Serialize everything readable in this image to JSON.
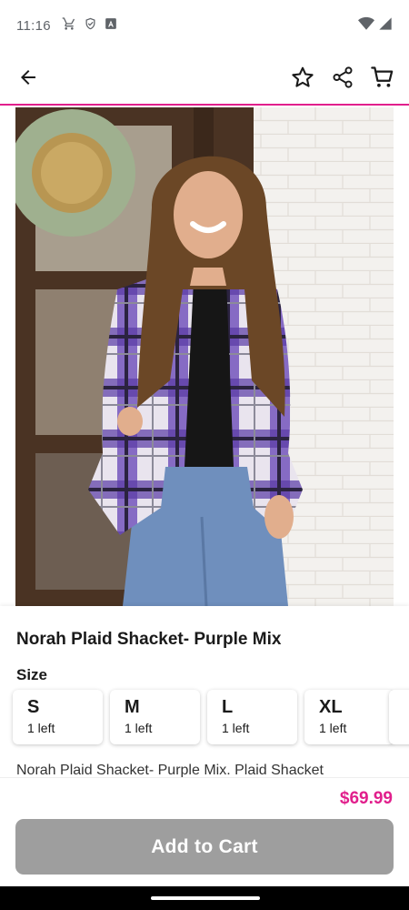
{
  "status_bar": {
    "time": "11:16",
    "icons": [
      "cart-icon",
      "shield-icon",
      "a-box-icon"
    ],
    "right_icons": [
      "wifi-icon",
      "signal-icon"
    ]
  },
  "app_bar": {
    "icons": [
      "back-arrow-icon",
      "star-outline-icon",
      "share-icon",
      "cart-icon"
    ]
  },
  "product": {
    "title": "Norah Plaid Shacket- Purple Mix",
    "size_label": "Size",
    "sizes": [
      {
        "size": "S",
        "stock": "1 left"
      },
      {
        "size": "M",
        "stock": "1 left"
      },
      {
        "size": "L",
        "stock": "1 left"
      },
      {
        "size": "XL",
        "stock": "1 left"
      }
    ],
    "description": "Norah Plaid Shacket- Purple Mix. Plaid Shacket"
  },
  "footer": {
    "price": "$69.99",
    "add_to_cart": "Add to Cart"
  },
  "colors": {
    "accent": "#e11f8c",
    "button_disabled": "#9e9e9e",
    "text": "#1a1a1a"
  }
}
